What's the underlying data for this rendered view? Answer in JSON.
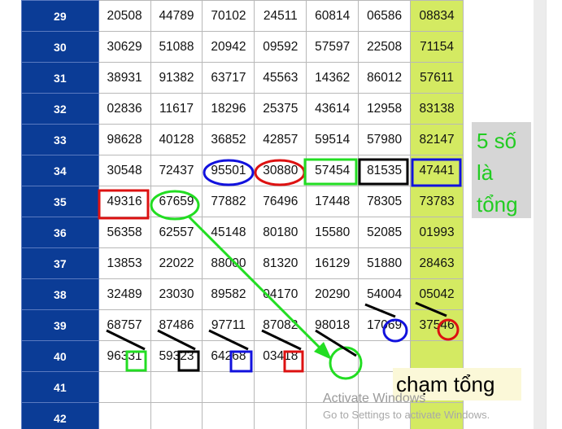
{
  "table": {
    "rows": [
      {
        "label": "29",
        "cells": [
          "20508",
          "44789",
          "70102",
          "24511",
          "60814",
          "06586",
          "08834"
        ]
      },
      {
        "label": "30",
        "cells": [
          "30629",
          "51088",
          "20942",
          "09592",
          "57597",
          "22508",
          "71154"
        ]
      },
      {
        "label": "31",
        "cells": [
          "38931",
          "91382",
          "63717",
          "45563",
          "14362",
          "86012",
          "57611"
        ]
      },
      {
        "label": "32",
        "cells": [
          "02836",
          "11617",
          "18296",
          "25375",
          "43614",
          "12958",
          "83138"
        ]
      },
      {
        "label": "33",
        "cells": [
          "98628",
          "40128",
          "36852",
          "42857",
          "59514",
          "57980",
          "82147"
        ]
      },
      {
        "label": "34",
        "cells": [
          "30548",
          "72437",
          "95501",
          "30880",
          "57454",
          "81535",
          "47441"
        ]
      },
      {
        "label": "35",
        "cells": [
          "49316",
          "67659",
          "77882",
          "76496",
          "17448",
          "78305",
          "73783"
        ]
      },
      {
        "label": "36",
        "cells": [
          "56358",
          "62557",
          "45148",
          "80180",
          "15580",
          "52085",
          "01993"
        ]
      },
      {
        "label": "37",
        "cells": [
          "13853",
          "22022",
          "88000",
          "81320",
          "16129",
          "51880",
          "28463"
        ]
      },
      {
        "label": "38",
        "cells": [
          "32489",
          "23030",
          "89582",
          "04170",
          "20290",
          "54004",
          "05042"
        ]
      },
      {
        "label": "39",
        "cells": [
          "68757",
          "87486",
          "97711",
          "87082",
          "98018",
          "17069",
          "37546"
        ]
      },
      {
        "label": "40",
        "cells": [
          "96331",
          "59323",
          "64268",
          "03418",
          "",
          "",
          ""
        ]
      },
      {
        "label": "41",
        "cells": [
          "",
          "",
          "",
          "",
          "",
          "",
          ""
        ]
      },
      {
        "label": "42",
        "cells": [
          "",
          "",
          "",
          "",
          "",
          "",
          ""
        ]
      }
    ]
  },
  "annotations": {
    "note_sum": "5 số\nlà\ntổng",
    "note_touch": "chạm tổng",
    "colors": {
      "green": "#22dd22",
      "red": "#dd1111",
      "blue": "#1111dd",
      "black": "#000000",
      "header": "#0b3c96",
      "highlight_col": "#d4ea62"
    }
  },
  "watermark": {
    "line1": "Activate Windows",
    "line2": "Go to Settings to activate Windows."
  }
}
